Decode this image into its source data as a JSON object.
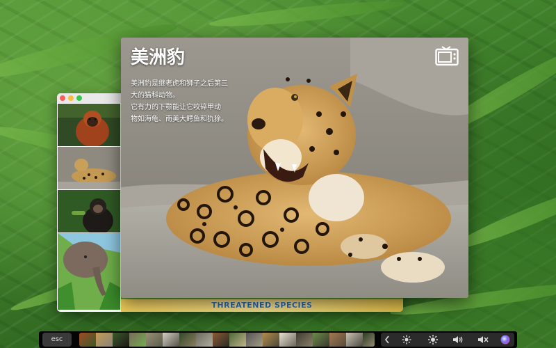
{
  "animal": {
    "title": "美洲豹",
    "description_lines": [
      "美洲豹是继老虎和狮子之后第三",
      "大的猫科动物。",
      "它有力的下颚能让它咬碎甲动",
      "物如海龟、南美大鳄鱼和犰狳。"
    ]
  },
  "back_window": {
    "banner": "THREATENED SPECIES",
    "thumbnails": [
      "orangutan",
      "jaguar",
      "chimpanzee",
      "elephant"
    ]
  },
  "touch_bar": {
    "esc_label": "esc",
    "controls": [
      "chevron-left-icon",
      "brightness-icon",
      "volume-icon",
      "mute-icon",
      "siri-icon"
    ]
  },
  "colors": {
    "banner_text": "#2a6fb0",
    "grass": "#3f7f2a"
  }
}
